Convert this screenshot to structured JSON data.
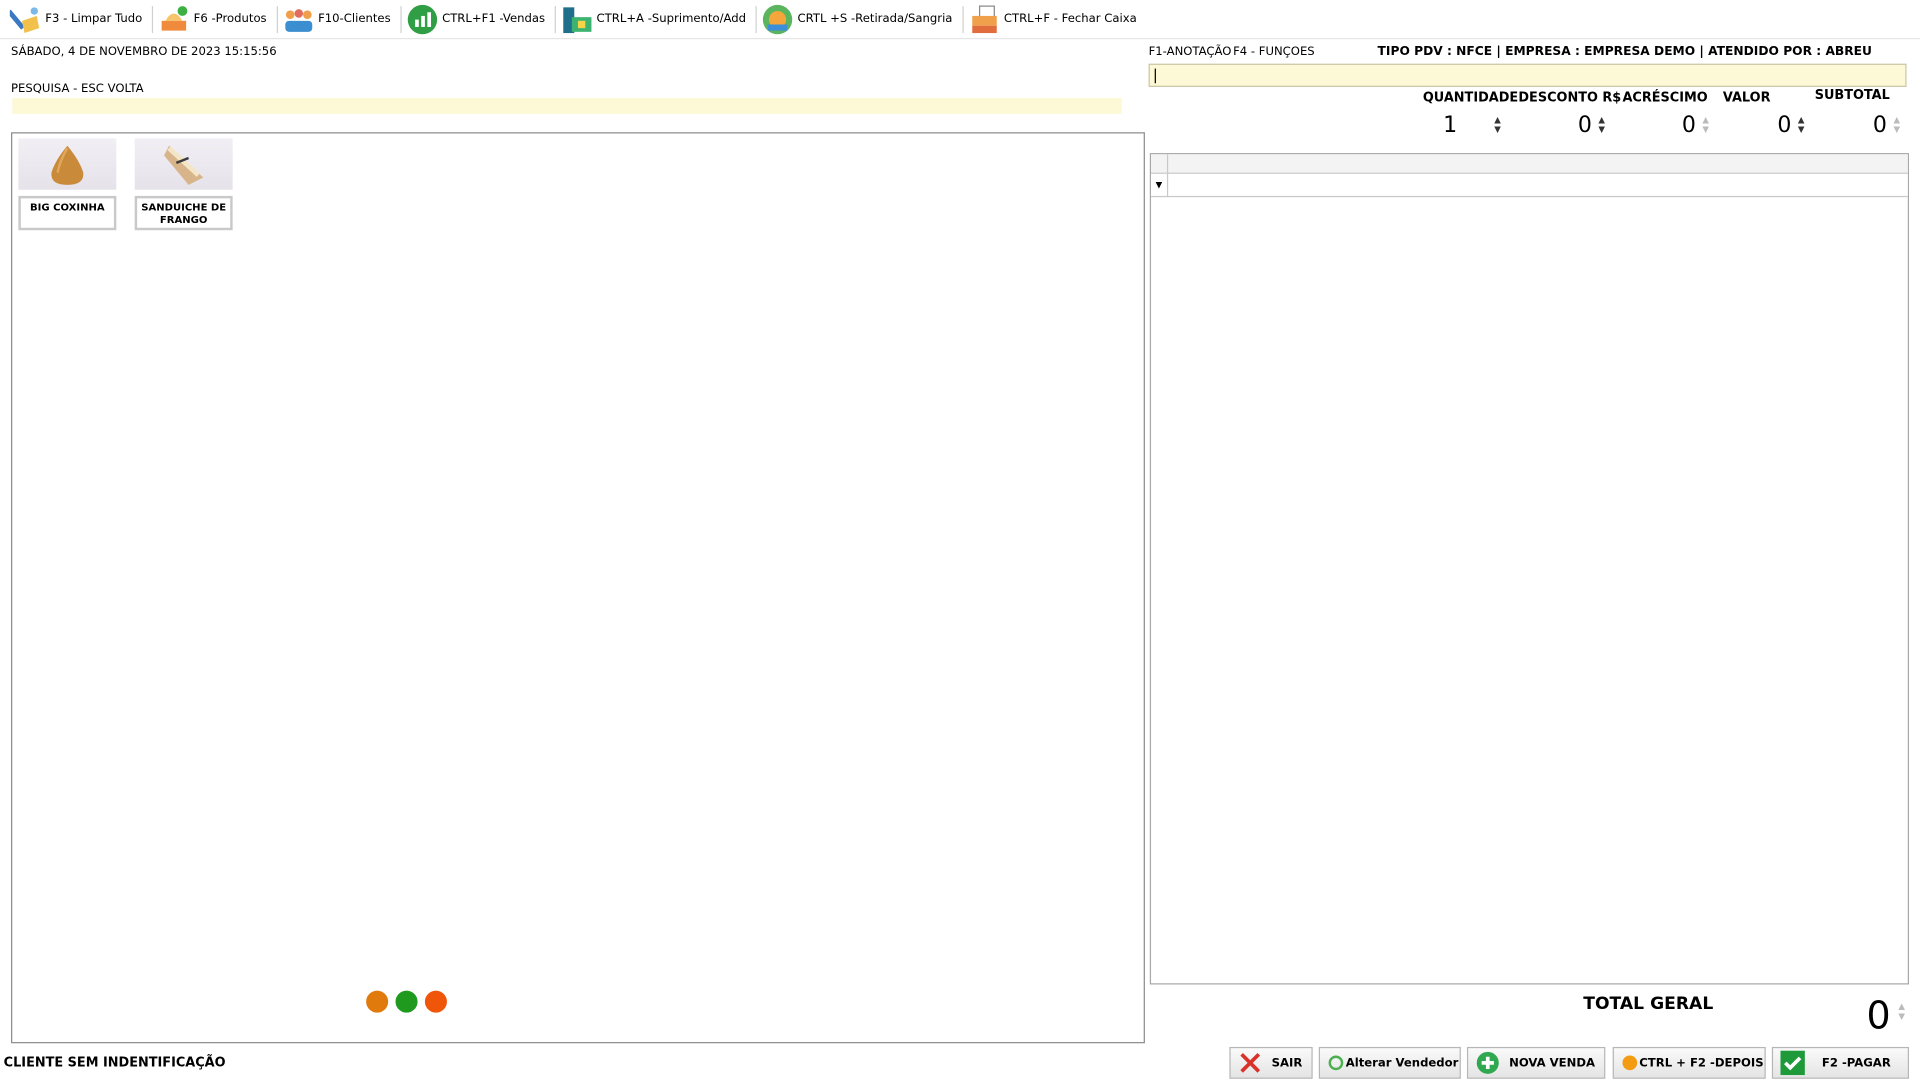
{
  "toolbar": {
    "items": [
      {
        "label": "F3 - Limpar Tudo",
        "icon": "broom-icon"
      },
      {
        "label": "F6 -Produtos",
        "icon": "products-icon"
      },
      {
        "label": "F10-Clientes",
        "icon": "clients-icon"
      },
      {
        "label": "CTRL+F1 -Vendas",
        "icon": "sales-chart-icon"
      },
      {
        "label": "CTRL+A -Suprimento/Add",
        "icon": "cash-add-icon"
      },
      {
        "label": "CRTL +S -Retirada/Sangria",
        "icon": "withdraw-icon"
      },
      {
        "label": "CTRL+F - Fechar Caixa",
        "icon": "register-icon"
      }
    ]
  },
  "datetime": "SÁBADO, 4 DE NOVEMBRO DE 2023 15:15:56",
  "search": {
    "label": "PESQUISA  - ESC VOLTA",
    "value": ""
  },
  "products": [
    {
      "name": "BIG COXINHA",
      "icon": "coxinha-image"
    },
    {
      "name": "SANDUICHE DE FRANGO",
      "icon": "sandwich-image"
    }
  ],
  "page_dots": {
    "colors": [
      "#e07a0c",
      "#1f9a1f",
      "#f0560a"
    ]
  },
  "hotkeys": {
    "notes": "F1-ANOTAÇÃO",
    "functions": "F4 - FUNÇOES"
  },
  "info": "TIPO PDV : NFCE  | EMPRESA : EMPRESA DEMO | ATENDIDO POR : ABREU",
  "notes_input": {
    "value": ""
  },
  "fields": {
    "quantidade": {
      "label": "QUANTIDADE",
      "value": "1"
    },
    "desconto": {
      "label": "DESCONTO R$",
      "value": "0"
    },
    "acrescimo": {
      "label": "ACRÉSCIMO",
      "value": "0"
    },
    "valor": {
      "label": "VALOR",
      "value": "0"
    },
    "subtotal": {
      "label": "SUBTOTAL",
      "value": "0"
    }
  },
  "grid": {
    "filter_icon": "▼"
  },
  "total": {
    "label": "TOTAL GERAL",
    "value": "0"
  },
  "client": "CLIENTE SEM INDENTIFICAÇÃO",
  "buttons": {
    "sair": "SAIR",
    "alterar": "Alterar Vendedor",
    "nova": "NOVA VENDA",
    "depois": "CTRL + F2 -DEPOIS",
    "pagar": "F2 -PAGAR"
  },
  "colors": {
    "input_bg": "#fdf9d6",
    "pay_green": "#1f9a3a",
    "exit_red": "#d9322a"
  }
}
